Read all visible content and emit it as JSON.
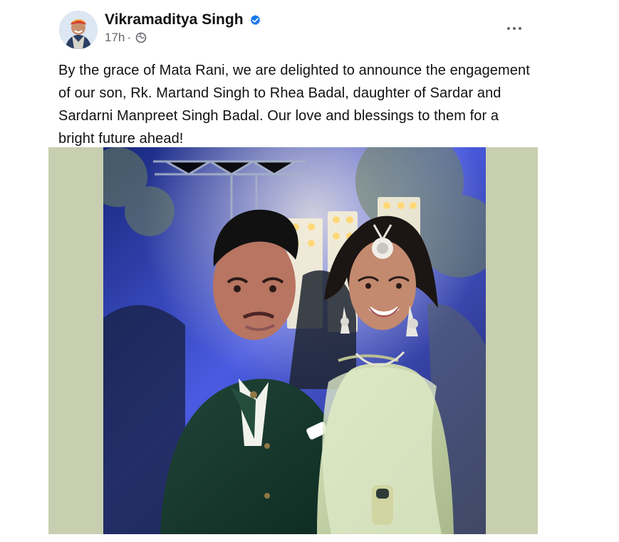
{
  "post": {
    "author_name": "Vikramaditya Singh",
    "timestamp": "17h",
    "separator": "·",
    "privacy_icon": "globe-icon",
    "verified_icon": "verified-badge-icon",
    "more_icon": "more-options-icon",
    "text": "By the grace of Mata Rani, we are delighted to announce the engagement of our son, Rk. Martand Singh to Rhea Badal, daughter of Sardar and Sardarni Manpreet Singh Badal. Our love and blessings to them for a bright future ahead!"
  },
  "colors": {
    "verified": "#1877f2",
    "meta_text": "#65676b",
    "media_background": "#c8cfb0"
  }
}
